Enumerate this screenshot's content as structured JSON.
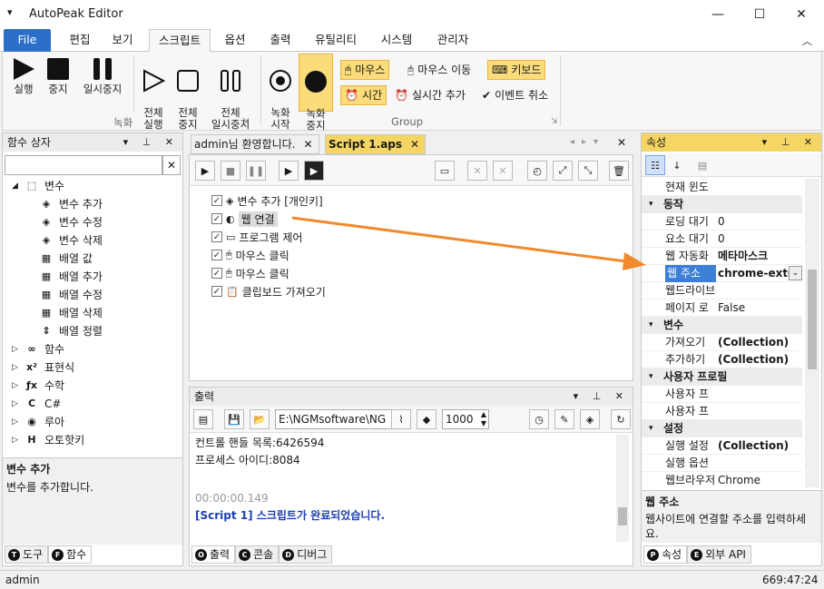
{
  "app": {
    "title": "AutoPeak Editor"
  },
  "ribbon_tabs": [
    "File",
    "편집",
    "보기",
    "스크립트",
    "옵션",
    "출력",
    "유틸리티",
    "시스템",
    "관리자"
  ],
  "ribbon": {
    "run": "실행",
    "stop": "중지",
    "pause": "일시중지",
    "run_all": "전체\n실행",
    "stop_all": "전체\n중지",
    "pause_all": "전체\n일시중지",
    "rec_start": "녹화\n시작",
    "rec_stop": "녹화\n중지",
    "mouse": "마우스",
    "mouse_move": "마우스 이동",
    "keyboard": "키보드",
    "time": "시간",
    "realtime_add": "실시간 추가",
    "event_cancel": "이벤트 취소",
    "group_record": "녹화",
    "group_group": "Group"
  },
  "function_box": {
    "title": "함수 상자",
    "search_value": "",
    "items": [
      {
        "label": "변수",
        "level": 0,
        "expanded": true
      },
      {
        "label": "변수 추가",
        "level": 1
      },
      {
        "label": "변수 수정",
        "level": 1
      },
      {
        "label": "변수 삭제",
        "level": 1
      },
      {
        "label": "배열 값",
        "level": 1
      },
      {
        "label": "배열 추가",
        "level": 1
      },
      {
        "label": "배열 수정",
        "level": 1
      },
      {
        "label": "배열 삭제",
        "level": 1
      },
      {
        "label": "배열 정렬",
        "level": 1
      },
      {
        "label": "함수",
        "level": 0
      },
      {
        "label": "표현식",
        "level": 0
      },
      {
        "label": "수학",
        "level": 0
      },
      {
        "label": "C#",
        "level": 0
      },
      {
        "label": "루아",
        "level": 0
      },
      {
        "label": "오토핫키",
        "level": 0
      }
    ],
    "desc_title": "변수 추가",
    "desc_text": "변수를 추가합니다.",
    "bottom_tabs": [
      "도구",
      "함수"
    ]
  },
  "editor": {
    "tabs": [
      "admin님 환영합니다.",
      "Script 1.aps"
    ],
    "lines": [
      "변수 추가 [개인키]",
      "웹 연결",
      "프로그램 제어",
      "마우스 클릭",
      "마우스 클릭",
      "클립보드 가져오기"
    ]
  },
  "output": {
    "title": "출력",
    "path": "E:\\NGMsoftware\\NG",
    "delay": "1000",
    "lines": [
      "컨트롤 핸들 목록:6426594",
      "프로세스 아이디:8084",
      "",
      "00:00:00.149",
      "[Script 1] 스크립트가 완료되었습니다."
    ],
    "bottom_tabs": [
      "출력",
      "콘솔",
      "디버그"
    ]
  },
  "properties": {
    "title": "속성",
    "rows": [
      {
        "type": "row",
        "name": "현재 윈도",
        "value": ""
      },
      {
        "type": "cat",
        "name": "동작"
      },
      {
        "type": "row",
        "name": "로딩 대기",
        "value": "0"
      },
      {
        "type": "row",
        "name": "요소 대기",
        "value": "0"
      },
      {
        "type": "row",
        "name": "웹 자동화",
        "value": "메타마스크",
        "bold": true
      },
      {
        "type": "row",
        "name": "웹 주소",
        "value": "chrome-exter",
        "bold": true,
        "selected": true
      },
      {
        "type": "row",
        "name": "웹드라이브",
        "value": ""
      },
      {
        "type": "row",
        "name": "페이지 로",
        "value": "False"
      },
      {
        "type": "cat",
        "name": "변수"
      },
      {
        "type": "row",
        "name": "가져오기",
        "value": "(Collection)",
        "bold": true
      },
      {
        "type": "row",
        "name": "추가하기",
        "value": "(Collection)",
        "bold": true
      },
      {
        "type": "cat",
        "name": "사용자 프로필"
      },
      {
        "type": "row",
        "name": "사용자 프",
        "value": ""
      },
      {
        "type": "row",
        "name": "사용자 프",
        "value": ""
      },
      {
        "type": "cat",
        "name": "설정"
      },
      {
        "type": "row",
        "name": "실행 설정",
        "value": "(Collection)",
        "bold": true
      },
      {
        "type": "row",
        "name": "실행 옵션",
        "value": ""
      },
      {
        "type": "row",
        "name": "웹브라우저",
        "value": "Chrome"
      }
    ],
    "desc_title": "웹 주소",
    "desc_text": "웹사이트에 연결할 주소를 입력하세요.",
    "bottom_tabs": [
      "속성",
      "외부 API"
    ]
  },
  "status": {
    "user": "admin",
    "time": "669:47:24"
  },
  "colors": {
    "accent": "#2b6fc9",
    "highlight": "#fbdc7a",
    "arrow": "#f08a2c",
    "selected": "#3b7fd6"
  }
}
